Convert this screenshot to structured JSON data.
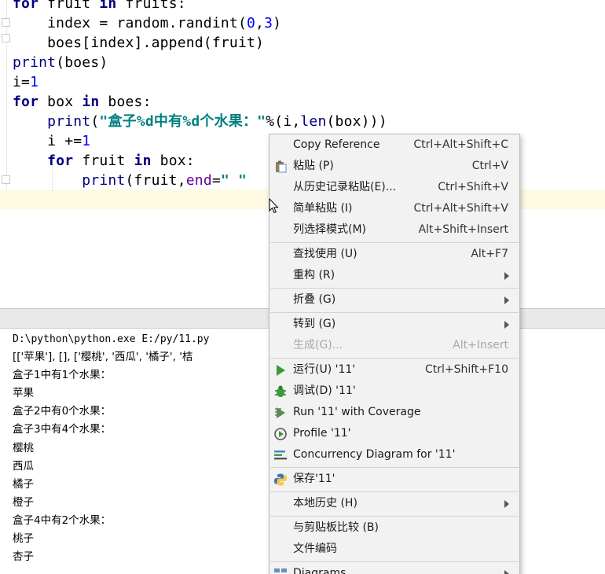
{
  "editor": {
    "lines": [
      {
        "parts": [
          [
            "kw",
            "for"
          ],
          [
            "",
            " fruit "
          ],
          [
            "kw",
            "in"
          ],
          [
            "",
            " fruits:"
          ]
        ]
      },
      {
        "parts": [
          [
            "",
            "    index = random.randint("
          ],
          [
            "num",
            "0"
          ],
          [
            "",
            ","
          ],
          [
            "num",
            "3"
          ],
          [
            "",
            ")"
          ]
        ]
      },
      {
        "parts": [
          [
            "",
            "    boes[index].append(fruit)"
          ]
        ]
      },
      {
        "parts": [
          [
            "bi",
            "print"
          ],
          [
            "",
            "(boes)"
          ]
        ]
      },
      {
        "parts": [
          [
            "",
            "i="
          ],
          [
            "num",
            "1"
          ]
        ]
      },
      {
        "parts": [
          [
            "kw",
            "for"
          ],
          [
            "",
            " box "
          ],
          [
            "kw",
            "in"
          ],
          [
            "",
            " boes:"
          ]
        ]
      },
      {
        "parts": [
          [
            "",
            "    "
          ],
          [
            "bi",
            "print"
          ],
          [
            "",
            "("
          ],
          [
            "str",
            "\"盒子%d中有%d个水果：\""
          ],
          [
            "",
            "%(i,"
          ],
          [
            "bi",
            "len"
          ],
          [
            "",
            "(box)))"
          ]
        ]
      },
      {
        "parts": [
          [
            "",
            "    i +="
          ],
          [
            "num",
            "1"
          ]
        ]
      },
      {
        "parts": [
          [
            "",
            "    "
          ],
          [
            "kw",
            "for"
          ],
          [
            "",
            " fruit "
          ],
          [
            "kw",
            "in"
          ],
          [
            "",
            " box:"
          ]
        ]
      },
      {
        "parts": [
          [
            "",
            "        "
          ],
          [
            "bi",
            "print"
          ],
          [
            "",
            "(fruit,"
          ],
          [
            "kwarg",
            "end"
          ],
          [
            "",
            "="
          ],
          [
            "str",
            "\" \""
          ]
        ]
      }
    ]
  },
  "console": {
    "command": "D:\\python\\python.exe E:/py/11.py",
    "lines": [
      "[['苹果'], [], ['樱桃', '西瓜', '橘子', '桔",
      "盒子1中有1个水果：",
      "苹果",
      "盒子2中有0个水果：",
      "盒子3中有4个水果：",
      "樱桃",
      "西瓜",
      "橘子",
      "橙子",
      "盒子4中有2个水果：",
      "桃子",
      "杏子"
    ]
  },
  "context_menu": {
    "items": [
      {
        "name": "copy-reference",
        "label": "Copy Reference",
        "shortcut": "Ctrl+Alt+Shift+C",
        "icon": ""
      },
      {
        "name": "paste",
        "label": "粘贴 (P)",
        "shortcut": "Ctrl+V",
        "icon": "clipboard-icon"
      },
      {
        "name": "paste-from-history",
        "label": "从历史记录粘贴(E)...",
        "shortcut": "Ctrl+Shift+V",
        "icon": ""
      },
      {
        "name": "paste-simple",
        "label": "简单粘贴 (I)",
        "shortcut": "Ctrl+Alt+Shift+V",
        "icon": ""
      },
      {
        "name": "column-selection-mode",
        "label": "列选择模式(M)",
        "shortcut": "Alt+Shift+Insert",
        "icon": ""
      },
      {
        "sep": true
      },
      {
        "name": "find-usages",
        "label": "查找使用 (U)",
        "shortcut": "Alt+F7",
        "icon": ""
      },
      {
        "name": "refactor",
        "label": "重构 (R)",
        "shortcut": "",
        "submenu": true,
        "icon": ""
      },
      {
        "sep": true
      },
      {
        "name": "folding",
        "label": "折叠 (G)",
        "shortcut": "",
        "submenu": true,
        "icon": ""
      },
      {
        "sep": true
      },
      {
        "name": "goto",
        "label": "转到 (G)",
        "shortcut": "",
        "submenu": true,
        "icon": ""
      },
      {
        "name": "generate",
        "label": "生成(G)...",
        "shortcut": "Alt+Insert",
        "disabled": true,
        "icon": ""
      },
      {
        "sep": true
      },
      {
        "name": "run",
        "label": "运行(U) '11'",
        "shortcut": "Ctrl+Shift+F10",
        "icon": "run-icon"
      },
      {
        "name": "debug",
        "label": "调试(D) '11'",
        "shortcut": "",
        "icon": "debug-bug-icon"
      },
      {
        "name": "run-with-coverage",
        "label": "Run '11' with Coverage",
        "shortcut": "",
        "icon": "coverage-icon"
      },
      {
        "name": "profile",
        "label": "Profile '11'",
        "shortcut": "",
        "icon": "profile-icon"
      },
      {
        "name": "concurrency-diagram",
        "label": "Concurrency Diagram for  '11'",
        "shortcut": "",
        "icon": "concurrency-icon"
      },
      {
        "sep": true
      },
      {
        "name": "save",
        "label": "保存'11'",
        "shortcut": "",
        "icon": "python-icon"
      },
      {
        "sep": true
      },
      {
        "name": "local-history",
        "label": "本地历史 (H)",
        "shortcut": "",
        "submenu": true,
        "icon": ""
      },
      {
        "sep": true
      },
      {
        "name": "compare-with-clipboard",
        "label": "与剪贴板比较 (B)",
        "shortcut": "",
        "icon": ""
      },
      {
        "name": "file-encoding",
        "label": "文件编码",
        "shortcut": "",
        "icon": ""
      },
      {
        "sep": true
      },
      {
        "name": "diagrams",
        "label": "Diagrams",
        "shortcut": "",
        "submenu": true,
        "icon": "diagram-icon"
      }
    ]
  },
  "colors": {
    "keyword": "#000080",
    "number": "#0000ff",
    "string": "#008080",
    "kwarg": "#660099",
    "menu_bg": "#f2f2f2",
    "run_green": "#3c9a3c"
  }
}
